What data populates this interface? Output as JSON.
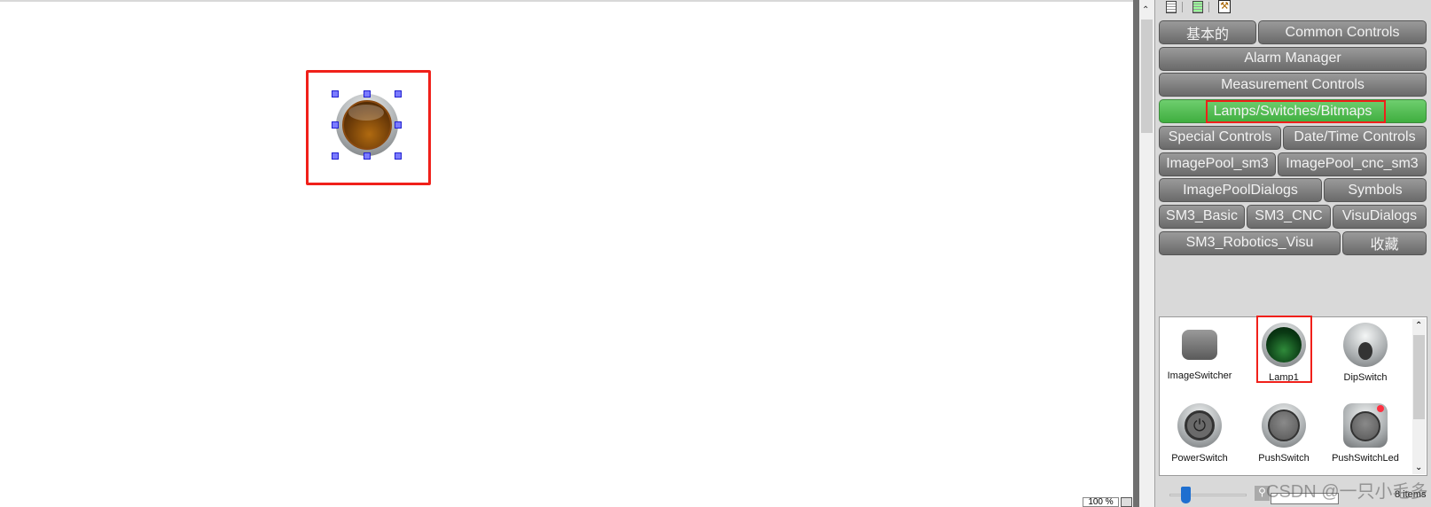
{
  "canvas": {
    "selected_element": "lamp",
    "lamp_color": "#6b3a08"
  },
  "zoom_box": {
    "value": "100 %"
  },
  "toolbox": {
    "categories": [
      [
        "基本的",
        "Common Controls"
      ],
      [
        "Alarm Manager"
      ],
      [
        "Measurement Controls"
      ],
      [
        "Lamps/Switches/Bitmaps"
      ],
      [
        "Special Controls",
        "Date/Time Controls"
      ],
      [
        "ImagePool_sm3",
        "ImagePool_cnc_sm3"
      ],
      [
        "ImagePoolDialogs",
        "Symbols"
      ],
      [
        "SM3_Basic",
        "SM3_CNC",
        "VisuDialogs"
      ],
      [
        "SM3_Robotics_Visu",
        "收藏"
      ]
    ],
    "active_category": "Lamps/Switches/Bitmaps",
    "active_color": "#4fbf4f",
    "items": [
      {
        "label": "ImageSwitcher",
        "icon": "camera-switch-icon"
      },
      {
        "label": "Lamp1",
        "icon": "green-lamp-icon"
      },
      {
        "label": "DipSwitch",
        "icon": "toggle-switch-icon"
      },
      {
        "label": "PowerSwitch",
        "icon": "power-button-icon"
      },
      {
        "label": "PushSwitch",
        "icon": "push-button-icon"
      },
      {
        "label": "PushSwitchLed",
        "icon": "push-button-led-icon"
      }
    ],
    "item_count": "8 items",
    "search_value": ""
  },
  "watermark": "CSDN @一只小毛多"
}
